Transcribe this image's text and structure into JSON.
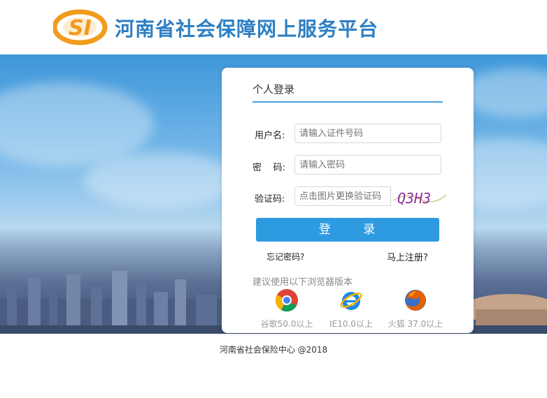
{
  "header": {
    "logo_text": "SI",
    "site_title": "河南省社会保障网上服务平台"
  },
  "login": {
    "title": "个人登录",
    "username_label": "用户名:",
    "username_placeholder": "请输入证件号码",
    "password_label": "密    码:",
    "password_placeholder": "请输入密码",
    "captcha_label": "验证码:",
    "captcha_placeholder": "点击图片更换验证码",
    "captcha_text": "Q3H3",
    "login_button": "登      录",
    "forgot_link": "忘记密码?",
    "register_link": "马上注册?"
  },
  "browsers": {
    "hint": "建议使用以下浏览器版本",
    "items": [
      {
        "icon": "chrome-icon",
        "label": "谷歌50.0以上"
      },
      {
        "icon": "ie-icon",
        "label": "IE10.0以上"
      },
      {
        "icon": "firefox-icon",
        "label": "火狐 37.0以上"
      }
    ]
  },
  "footer": {
    "text": "河南省社会保险中心 @2018"
  }
}
